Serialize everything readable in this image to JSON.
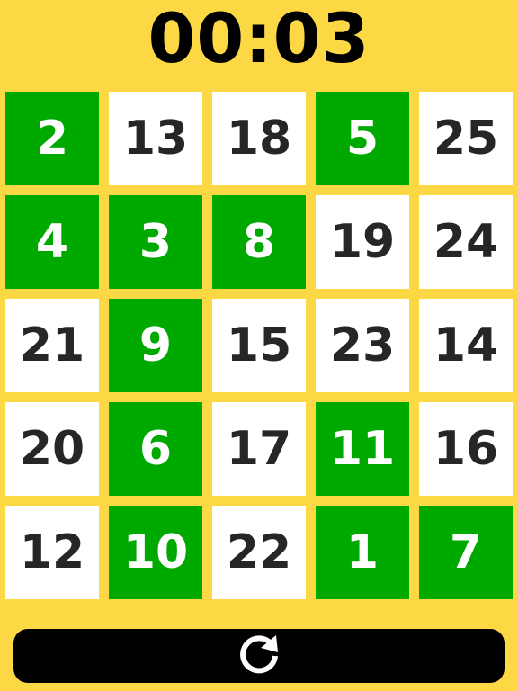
{
  "timer": {
    "display": "00:03"
  },
  "board": {
    "tiles": [
      {
        "number": "2",
        "found": true
      },
      {
        "number": "13",
        "found": false
      },
      {
        "number": "18",
        "found": false
      },
      {
        "number": "5",
        "found": true
      },
      {
        "number": "25",
        "found": false
      },
      {
        "number": "4",
        "found": true
      },
      {
        "number": "3",
        "found": true
      },
      {
        "number": "8",
        "found": true
      },
      {
        "number": "19",
        "found": false
      },
      {
        "number": "24",
        "found": false
      },
      {
        "number": "21",
        "found": false
      },
      {
        "number": "9",
        "found": true
      },
      {
        "number": "15",
        "found": false
      },
      {
        "number": "23",
        "found": false
      },
      {
        "number": "14",
        "found": false
      },
      {
        "number": "20",
        "found": false
      },
      {
        "number": "6",
        "found": true
      },
      {
        "number": "17",
        "found": false
      },
      {
        "number": "11",
        "found": true
      },
      {
        "number": "16",
        "found": false
      },
      {
        "number": "12",
        "found": false
      },
      {
        "number": "10",
        "found": true
      },
      {
        "number": "22",
        "found": false
      },
      {
        "number": "1",
        "found": true
      },
      {
        "number": "7",
        "found": true
      }
    ]
  },
  "restart_button": {
    "icon": "refresh-icon"
  },
  "colors": {
    "background": "#FCD845",
    "tile_found": "#00A900",
    "tile_default": "#FFFFFF",
    "text_dark": "#262626",
    "button": "#000000"
  }
}
